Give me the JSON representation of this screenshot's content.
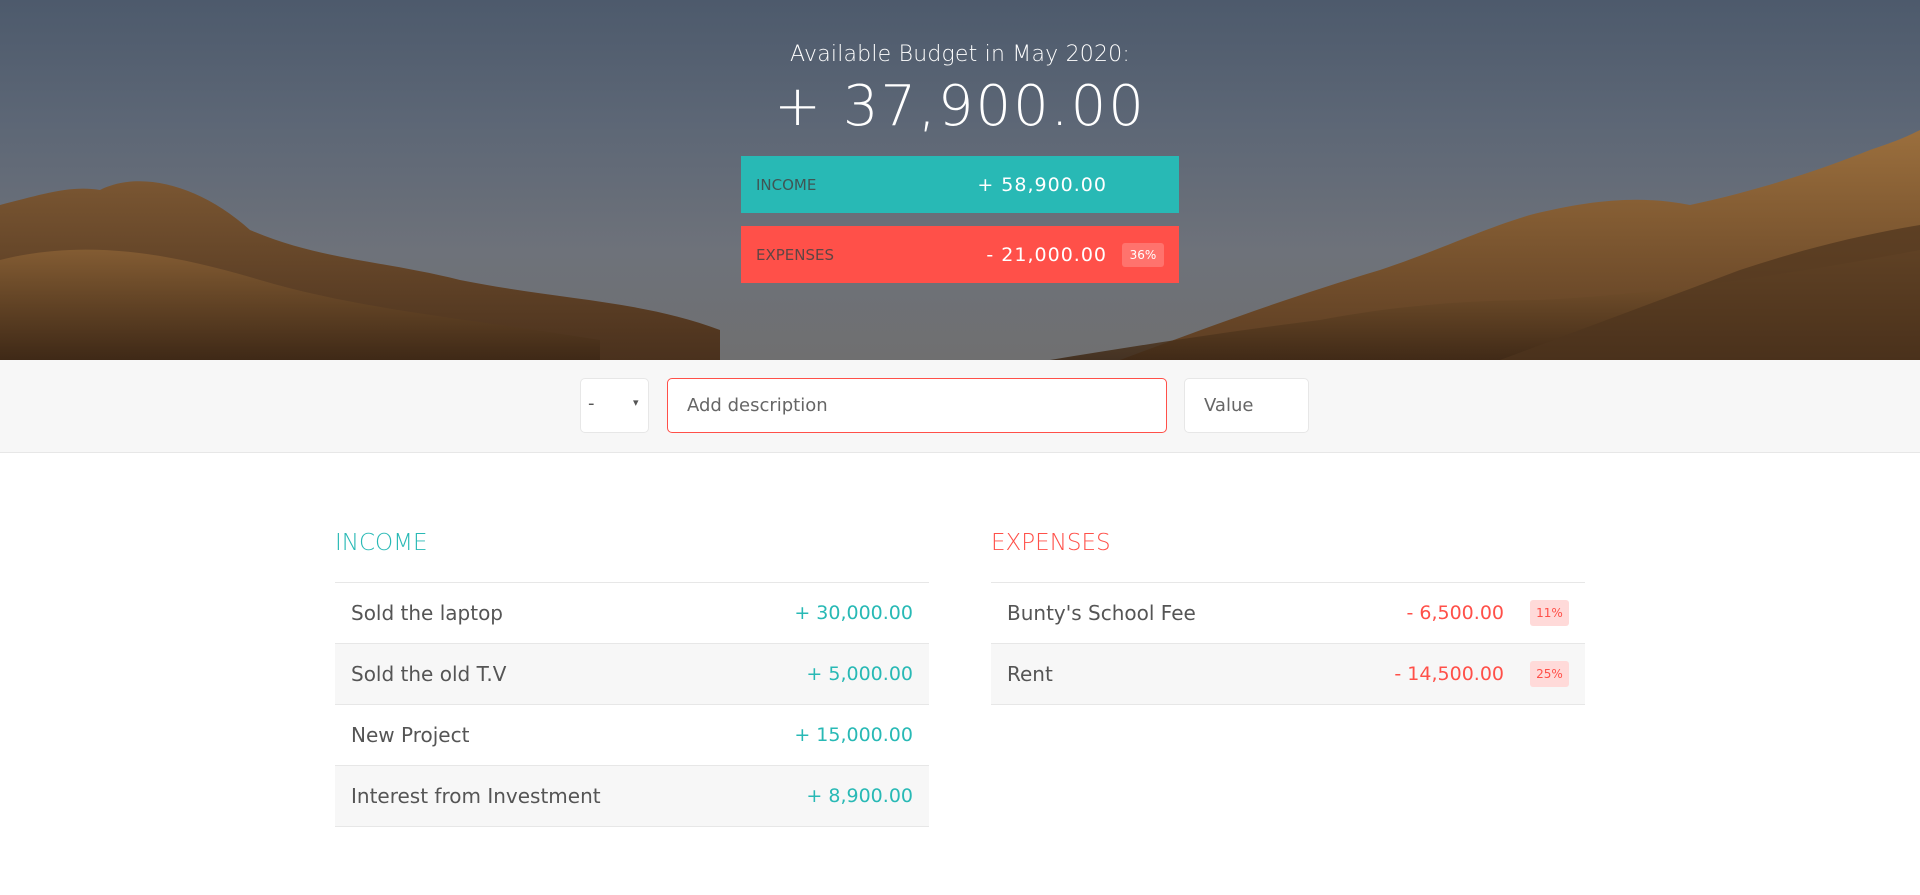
{
  "header": {
    "title": "Available Budget in May 2020:",
    "value": "+ 37,900.00",
    "income": {
      "label": "Income",
      "value": "+ 58,900.00"
    },
    "expenses": {
      "label": "Expenses",
      "value": "- 21,000.00",
      "percentage": "36%"
    }
  },
  "add_bar": {
    "type_value": "-",
    "type_arrow": "▾",
    "description_placeholder": "Add description",
    "value_placeholder": "Value"
  },
  "income": {
    "title": "Income",
    "items": [
      {
        "description": "Sold the laptop",
        "value": "+ 30,000.00"
      },
      {
        "description": "Sold the old T.V",
        "value": "+ 5,000.00"
      },
      {
        "description": "New Project",
        "value": "+ 15,000.00"
      },
      {
        "description": "Interest from Investment",
        "value": "+ 8,900.00"
      }
    ]
  },
  "expenses": {
    "title": "Expenses",
    "items": [
      {
        "description": "Bunty's School Fee",
        "value": "- 6,500.00",
        "percentage": "11%"
      },
      {
        "description": "Rent",
        "value": "- 14,500.00",
        "percentage": "25%"
      }
    ]
  },
  "colors": {
    "income": "#28b9b5",
    "expenses": "#ff5049",
    "percentage_badge_bg": "#ffdad9",
    "row_alt_bg": "#f7f7f7"
  }
}
